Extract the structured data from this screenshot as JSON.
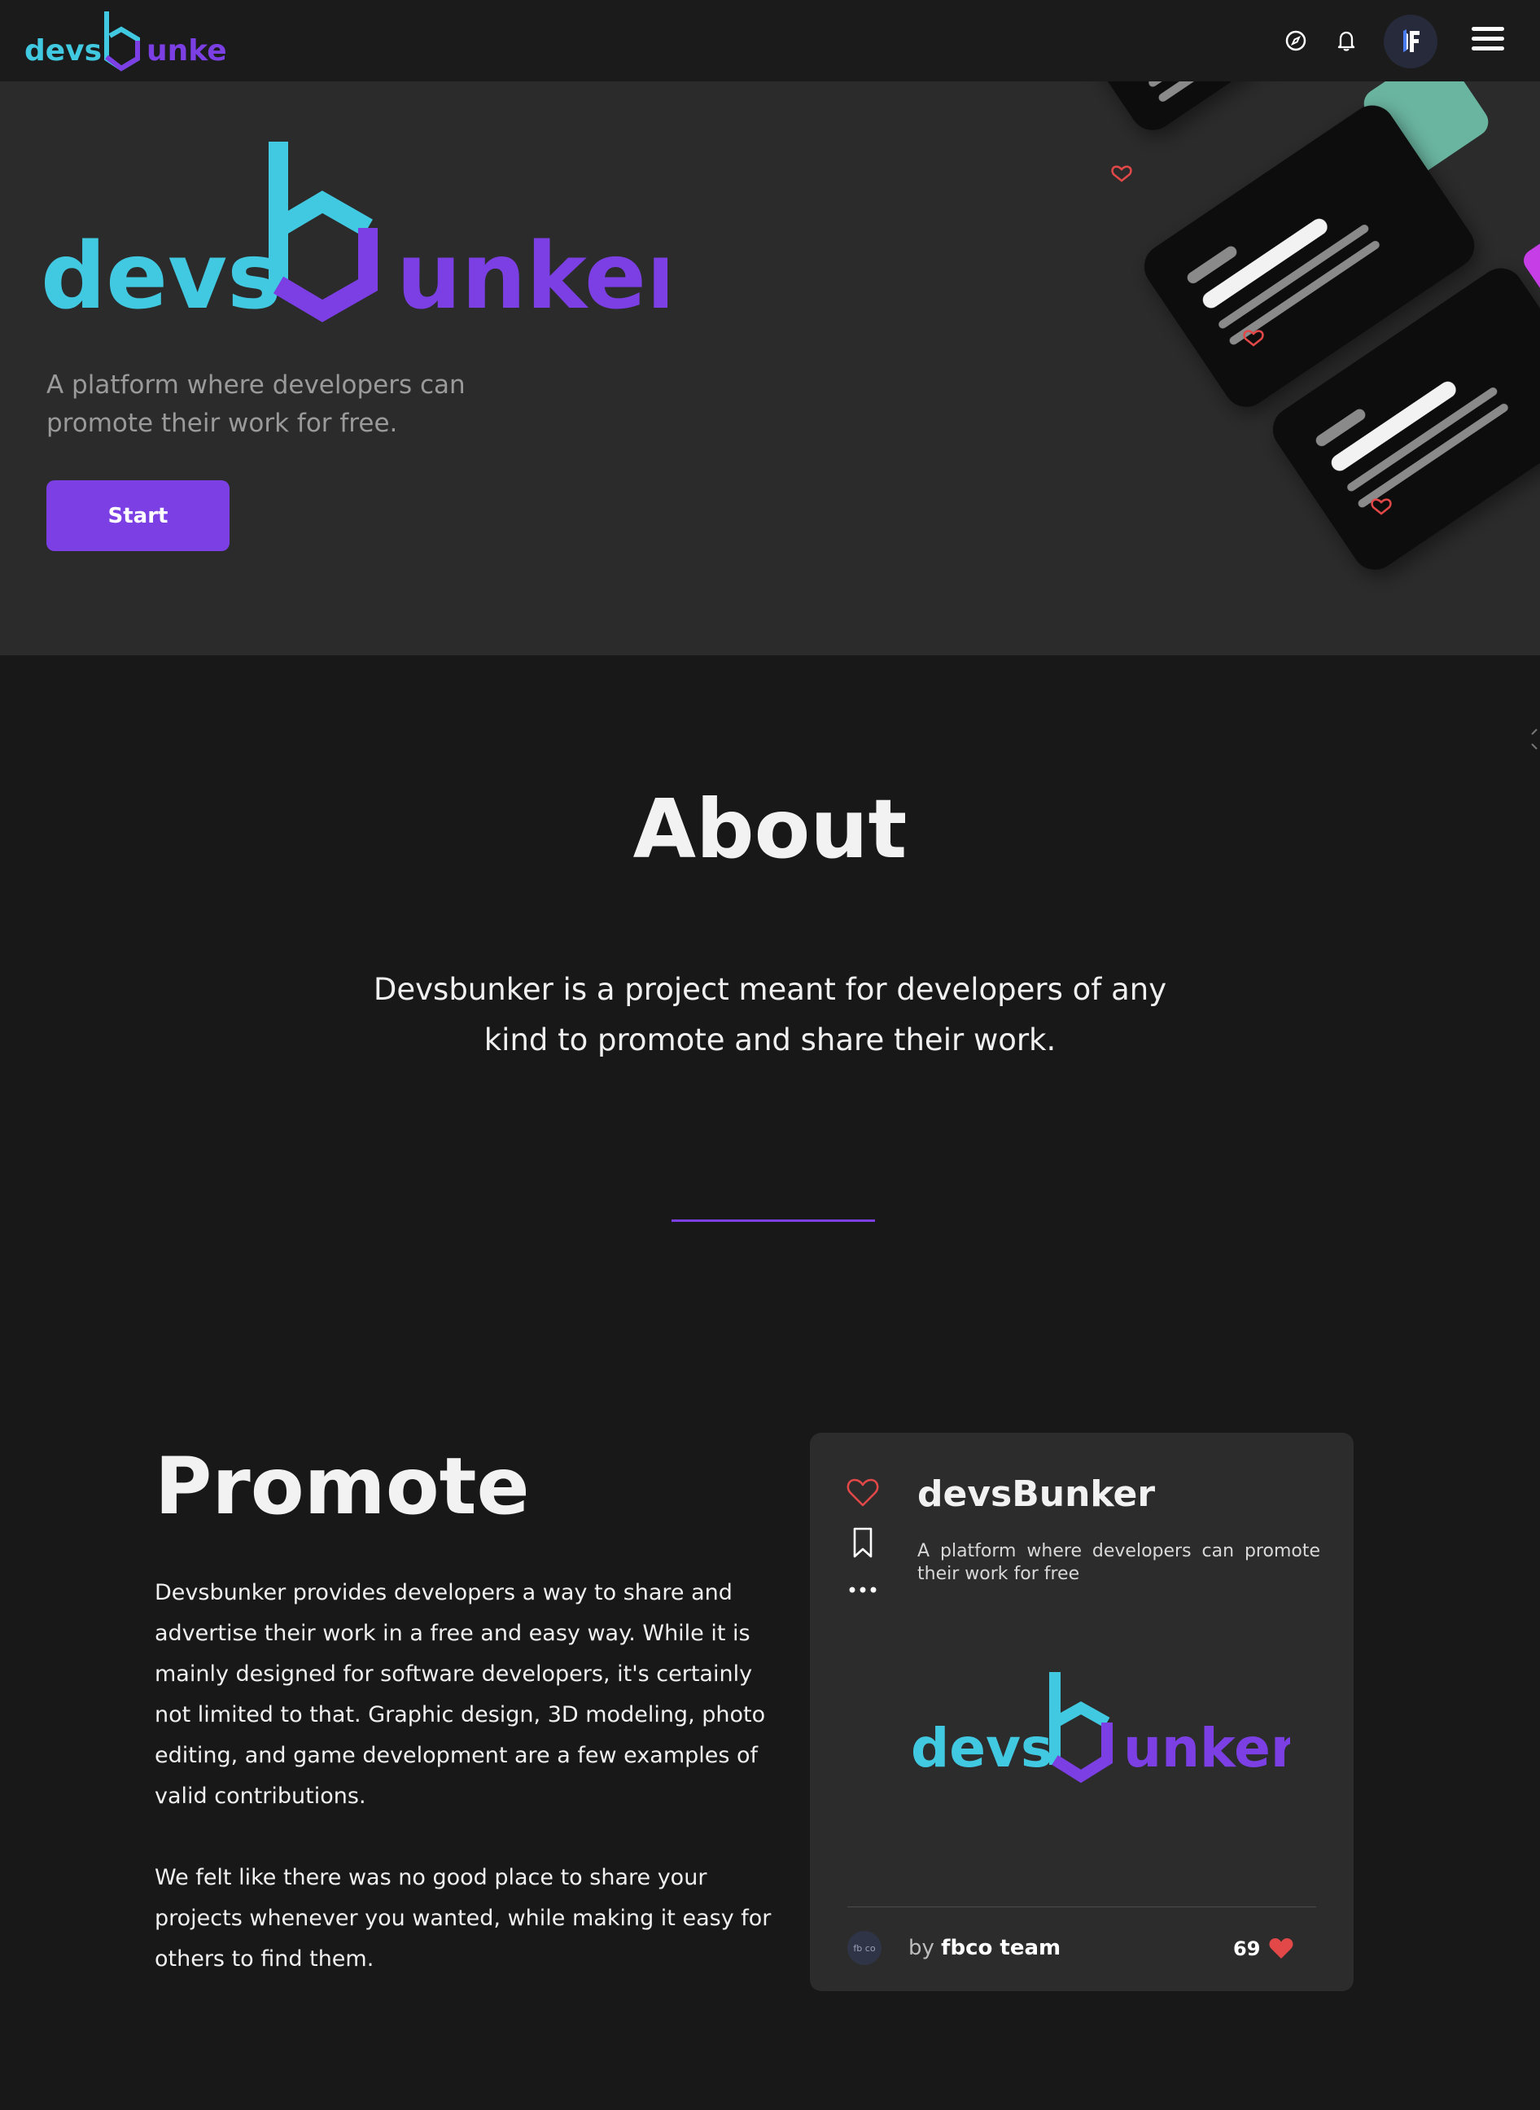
{
  "brand": {
    "logo_text_part1": "devs",
    "logo_text_part2": "unker",
    "color_cyan": "#41c9e2",
    "color_purple": "#7b3fe4"
  },
  "navbar": {
    "icons": [
      "compass-icon",
      "bell-icon",
      "avatar",
      "hamburger-menu-icon"
    ],
    "avatar_initial": "F"
  },
  "hero": {
    "tagline": "A platform where developers can\npromote their work for free.",
    "start_label": "Start"
  },
  "about": {
    "title": "About",
    "text": "Devsbunker is a project meant for developers of any kind to promote and share their work."
  },
  "promote": {
    "title": "Promote",
    "paragraph1": "Devsbunker provides developers a way to share and advertise their work in a free and easy way. While it is mainly designed for software developers, it's certainly not limited to that. Graphic design, 3D modeling, photo editing, and game development are a few examples of valid contributions.",
    "paragraph2": "We felt like there was no good place to share your projects whenever you wanted, while making it easy for others to find them."
  },
  "card": {
    "title": "devsBunker",
    "description": "A platform where developers can promote their work for free",
    "author_prefix": "by",
    "author_name": "fbco team",
    "avatar_text": "fb co",
    "likes": "69"
  }
}
